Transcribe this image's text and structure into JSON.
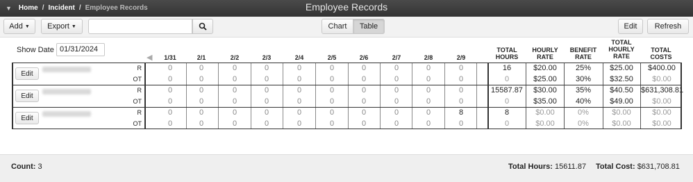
{
  "breadcrumb": {
    "home": "Home",
    "incident": "Incident",
    "current": "Employee Records",
    "sep": "/"
  },
  "window_title": "Employee Records",
  "toolbar": {
    "add_label": "Add",
    "export_label": "Export",
    "search_value": "",
    "chart_label": "Chart",
    "table_label": "Table",
    "edit_label": "Edit",
    "refresh_label": "Refresh"
  },
  "show_date": {
    "label": "Show Date",
    "value": "01/31/2024"
  },
  "columns": {
    "dates": [
      "1/31",
      "2/1",
      "2/2",
      "2/3",
      "2/4",
      "2/5",
      "2/6",
      "2/7",
      "2/8",
      "2/9"
    ],
    "total_hours": [
      "TOTAL",
      "HOURS"
    ],
    "hourly_rate": [
      "HOURLY",
      "RATE"
    ],
    "benefit_rate": [
      "BENEFIT",
      "RATE"
    ],
    "total_hourly_rate": [
      "TOTAL",
      "HOURLY",
      "RATE"
    ],
    "total_costs": [
      "TOTAL",
      "COSTS"
    ]
  },
  "employees": [
    {
      "edit_label": "Edit",
      "rows": [
        {
          "type": "R",
          "days": [
            "0",
            "0",
            "0",
            "0",
            "0",
            "0",
            "0",
            "0",
            "0",
            "0"
          ],
          "total_hours": "16",
          "hourly_rate": "$20.00",
          "benefit_rate": "25%",
          "total_hourly_rate": "$25.00",
          "total_costs": "$400.00"
        },
        {
          "type": "OT",
          "days": [
            "0",
            "0",
            "0",
            "0",
            "0",
            "0",
            "0",
            "0",
            "0",
            "0"
          ],
          "total_hours": "0",
          "hourly_rate": "$25.00",
          "benefit_rate": "30%",
          "total_hourly_rate": "$32.50",
          "total_costs": "$0.00"
        }
      ]
    },
    {
      "edit_label": "Edit",
      "rows": [
        {
          "type": "R",
          "days": [
            "0",
            "0",
            "0",
            "0",
            "0",
            "0",
            "0",
            "0",
            "0",
            "0"
          ],
          "total_hours": "15587.87",
          "hourly_rate": "$30.00",
          "benefit_rate": "35%",
          "total_hourly_rate": "$40.50",
          "total_costs": "$631,308.81"
        },
        {
          "type": "OT",
          "days": [
            "0",
            "0",
            "0",
            "0",
            "0",
            "0",
            "0",
            "0",
            "0",
            "0"
          ],
          "total_hours": "0",
          "hourly_rate": "$35.00",
          "benefit_rate": "40%",
          "total_hourly_rate": "$49.00",
          "total_costs": "$0.00"
        }
      ]
    },
    {
      "edit_label": "Edit",
      "rows": [
        {
          "type": "R",
          "days": [
            "0",
            "0",
            "0",
            "0",
            "0",
            "0",
            "0",
            "0",
            "0",
            "8"
          ],
          "total_hours": "8",
          "hourly_rate": "$0.00",
          "benefit_rate": "0%",
          "total_hourly_rate": "$0.00",
          "total_costs": "$0.00"
        },
        {
          "type": "OT",
          "days": [
            "0",
            "0",
            "0",
            "0",
            "0",
            "0",
            "0",
            "0",
            "0",
            "0"
          ],
          "total_hours": "0",
          "hourly_rate": "$0.00",
          "benefit_rate": "0%",
          "total_hourly_rate": "$0.00",
          "total_costs": "$0.00"
        }
      ]
    }
  ],
  "footer": {
    "count_label": "Count:",
    "count_value": "3",
    "total_hours_label": "Total Hours:",
    "total_hours_value": "15611.87",
    "total_cost_label": "Total Cost:",
    "total_cost_value": "$631,708.81"
  }
}
